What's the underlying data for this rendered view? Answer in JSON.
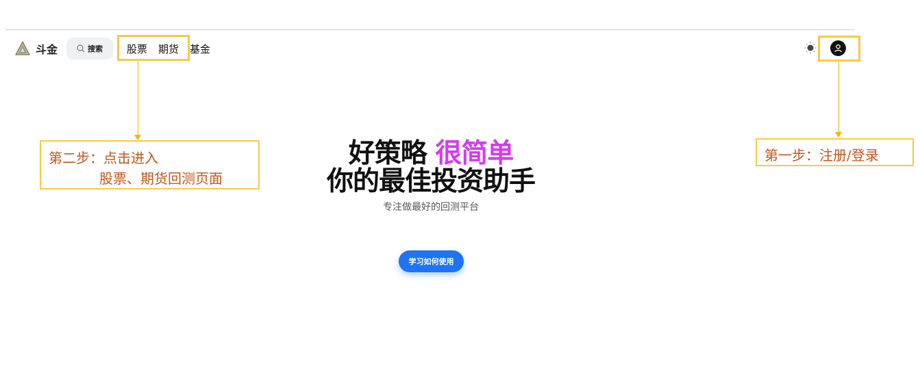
{
  "nav": {
    "logo_text": "斗金",
    "search_label": "搜索",
    "links": [
      {
        "label": "股票"
      },
      {
        "label": "期货"
      },
      {
        "label": "基金"
      }
    ]
  },
  "hero": {
    "title_part1": "好策略 ",
    "title_accent": "很简单",
    "title_line2": "你的最佳投资助手",
    "subtitle": "专注做最好的回测平台",
    "cta_label": "学习如何使用"
  },
  "annotations": {
    "step2_line1": "第二步：点击进入",
    "step2_line2": "股票、期货回测页面",
    "step1_label": "第一步：注册/登录"
  },
  "colors": {
    "accent": "#d33bf2",
    "primary_button": "#1d74f5",
    "highlight": "#f7c948",
    "callout_text": "#c0561a"
  },
  "icons": {
    "logo": "triangle-logo-icon",
    "search": "search-icon",
    "theme": "sun-icon",
    "user": "user-icon"
  }
}
